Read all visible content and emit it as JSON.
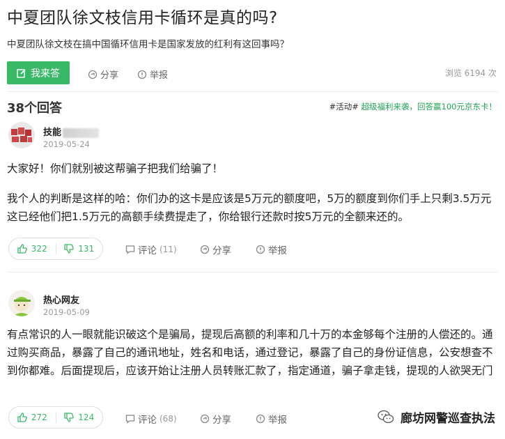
{
  "question": {
    "title": "中夏团队徐文枝信用卡循环是真的吗?",
    "description": "中夏团队徐文枝在搞中国循环信用卡是国家发放的红利有这回事吗？",
    "answer_button": "我来答",
    "share": "分享",
    "report": "举报",
    "views": "浏览 6194 次"
  },
  "answers_header": {
    "count": "38个回答",
    "promo_tag": "#活动#",
    "promo_text": "超级福利来袭，回答赢100元京东卡！"
  },
  "answers": [
    {
      "username": "技能",
      "date": "2019-05-24",
      "paragraphs": [
        "大家好！你们就别被这帮骗子把我们给骗了！",
        "我个人的判断是这样的哈：你们办的这卡是应该是5万元的额度吧，5万的额度到你们手上只剩3.5万元这已经他们把1.5万元的高额手续费提走了，你给银行还款时按5万元的全额来还的。"
      ],
      "upvotes": "322",
      "downvotes": "131",
      "comment": "评论",
      "comment_count": "(11)",
      "share": "分享",
      "report": "举报"
    },
    {
      "username": "热心网友",
      "date": "2019-05-09",
      "paragraphs": [
        "有点常识的人一眼就能识破这个是骗局，提现后高额的利率和几十万的本金够每个注册的人偿还的。通过购买商品，暴露了自己的通讯地址，姓名和电话，通过登记，暴露了自己的身份证信息，公安想查不到你都难。后面提现后，应该开始让注册人员转账汇款了，指定通道，骗子拿走钱，提现的人欲哭无门"
      ],
      "upvotes": "272",
      "downvotes": "124",
      "comment": "评论",
      "comment_count": "(68)",
      "share": "分享",
      "report": "举报"
    }
  ],
  "watermark": "廊坊网警巡查执法",
  "colors": {
    "accent": "#39b968",
    "promo": "#21a256"
  }
}
